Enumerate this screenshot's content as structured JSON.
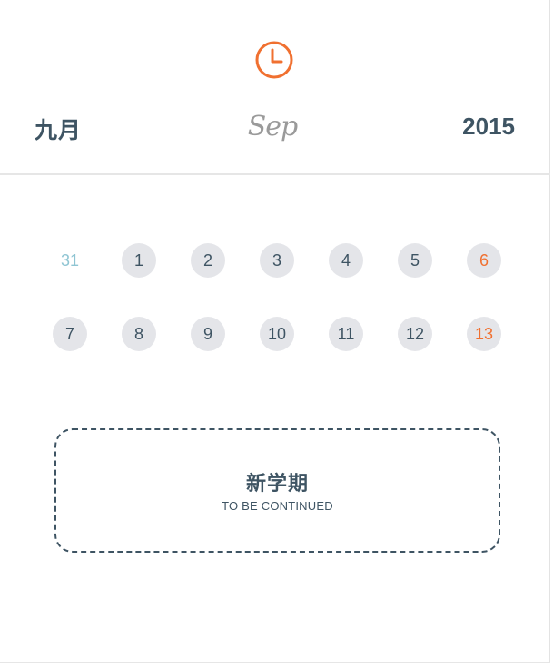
{
  "header": {
    "icon": "clock-icon",
    "month_cn": "九月",
    "month_en": "Sep",
    "year": "2015"
  },
  "colors": {
    "accent": "#f07030",
    "text": "#3e5463",
    "muted_day": "#8fc5d3",
    "day_bg": "#e4e5e9"
  },
  "calendar": {
    "days": [
      {
        "label": "31",
        "state": "muted"
      },
      {
        "label": "1",
        "state": "normal"
      },
      {
        "label": "2",
        "state": "normal"
      },
      {
        "label": "3",
        "state": "normal"
      },
      {
        "label": "4",
        "state": "normal"
      },
      {
        "label": "5",
        "state": "normal"
      },
      {
        "label": "6",
        "state": "weekend"
      },
      {
        "label": "7",
        "state": "normal"
      },
      {
        "label": "8",
        "state": "normal"
      },
      {
        "label": "9",
        "state": "normal"
      },
      {
        "label": "10",
        "state": "normal"
      },
      {
        "label": "11",
        "state": "normal"
      },
      {
        "label": "12",
        "state": "normal"
      },
      {
        "label": "13",
        "state": "weekend"
      }
    ]
  },
  "note": {
    "title": "新学期",
    "subtitle": "TO BE CONTINUED"
  }
}
